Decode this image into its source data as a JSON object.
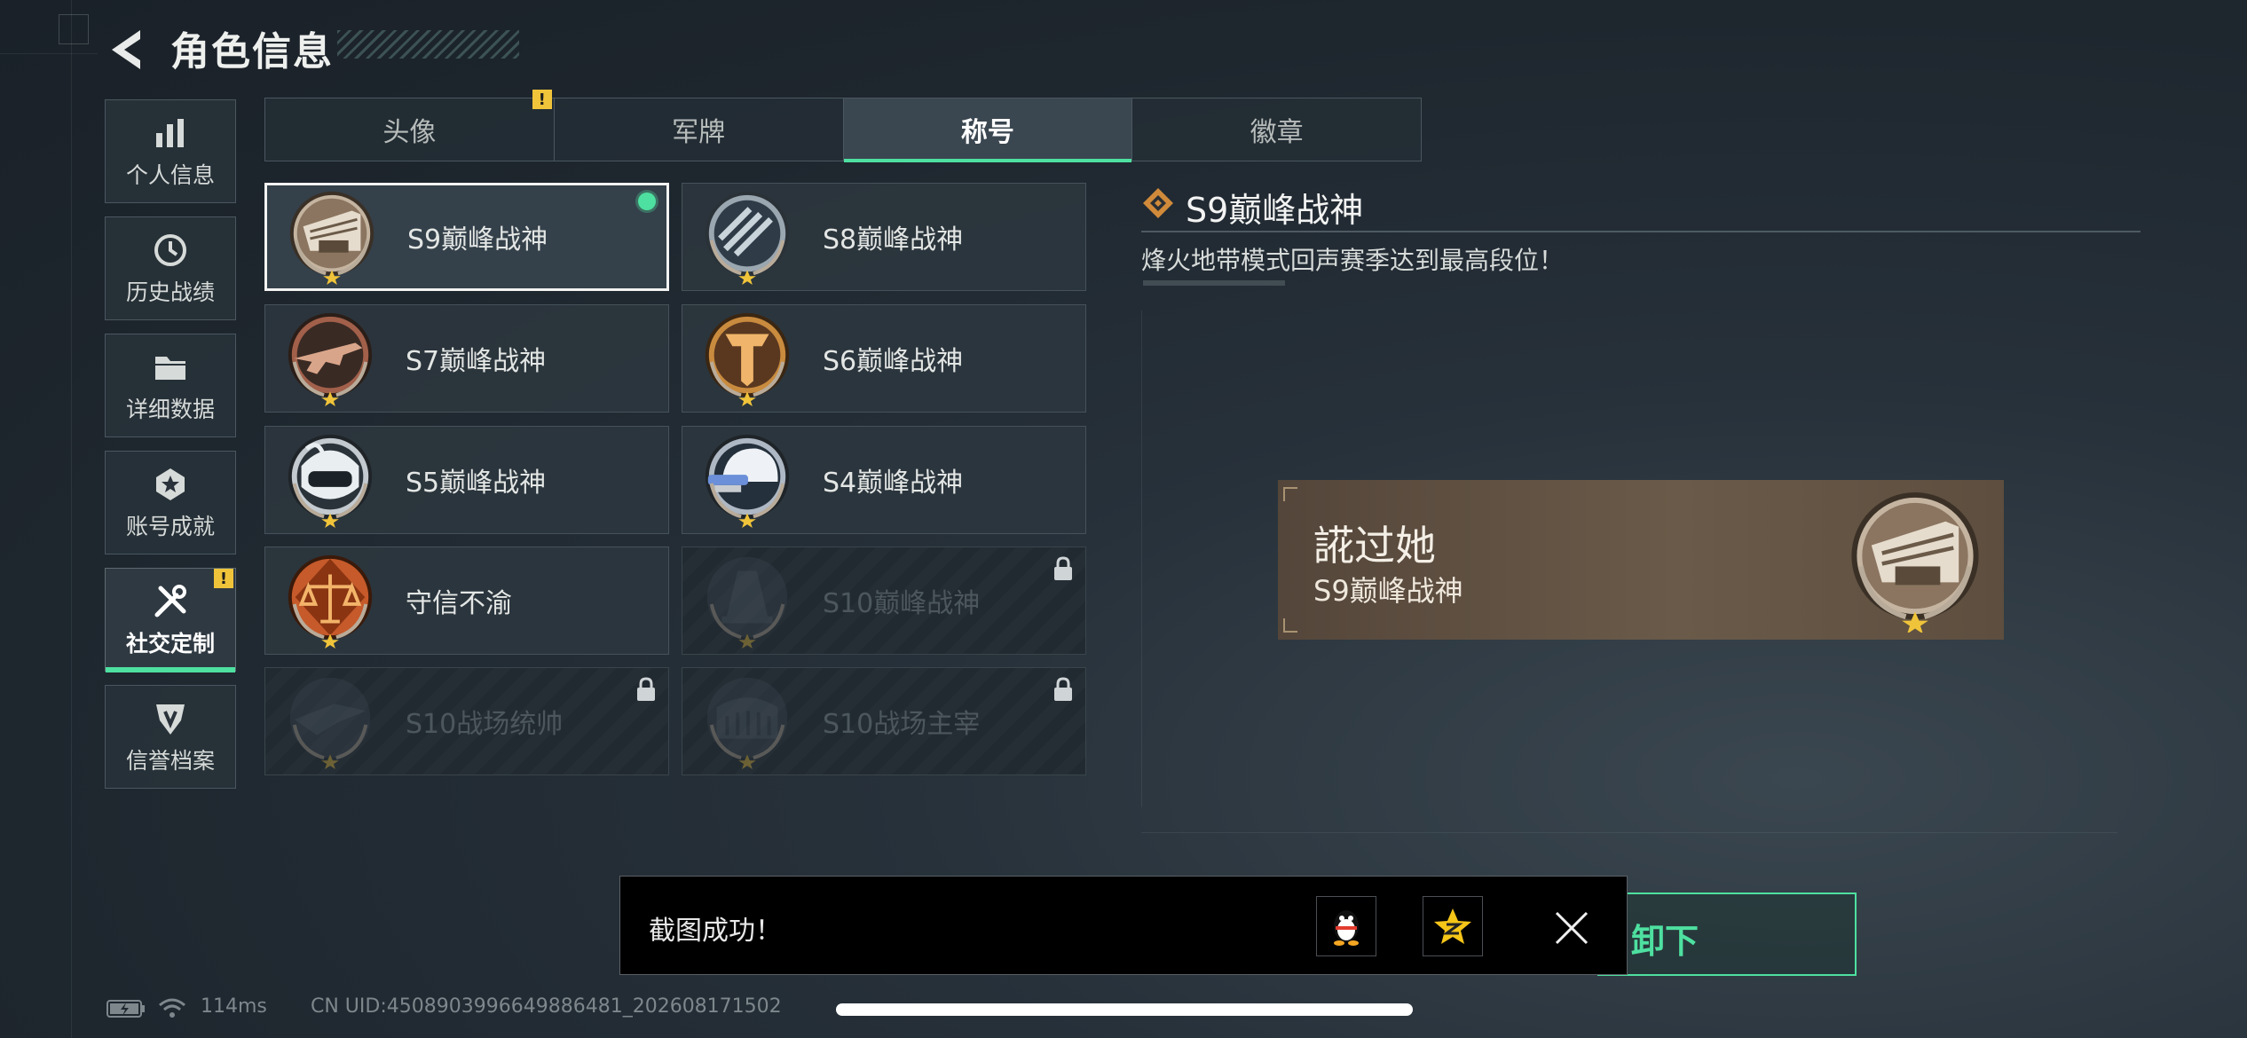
{
  "header": {
    "title": "角色信息"
  },
  "sidebar": {
    "items": [
      {
        "label": "个人信息",
        "icon": "bar-chart-icon"
      },
      {
        "label": "历史战绩",
        "icon": "clock-icon"
      },
      {
        "label": "详细数据",
        "icon": "folder-icon"
      },
      {
        "label": "账号成就",
        "icon": "medal-icon"
      },
      {
        "label": "社交定制",
        "icon": "tools-icon",
        "active": true,
        "alert": "!"
      },
      {
        "label": "信誉档案",
        "icon": "shield-icon"
      }
    ]
  },
  "tabs": [
    {
      "label": "头像",
      "alert": "!"
    },
    {
      "label": "军牌"
    },
    {
      "label": "称号",
      "active": true
    },
    {
      "label": "徽章"
    }
  ],
  "titles": [
    {
      "name": "S9巅峰战神",
      "selected": true,
      "equipped": true,
      "locked": false
    },
    {
      "name": "S8巅峰战神",
      "locked": false
    },
    {
      "name": "S7巅峰战神",
      "locked": false
    },
    {
      "name": "S6巅峰战神",
      "locked": false
    },
    {
      "name": "S5巅峰战神",
      "locked": false
    },
    {
      "name": "S4巅峰战神",
      "locked": false
    },
    {
      "name": "守信不渝",
      "locked": false
    },
    {
      "name": "S10巅峰战神",
      "locked": true
    },
    {
      "name": "S10战场统帅",
      "locked": true
    },
    {
      "name": "S10战场主宰",
      "locked": true
    }
  ],
  "detail": {
    "title": "S9巅峰战神",
    "description": "烽火地带模式回声赛季达到最高段位！",
    "preview_player_name": "誮过她",
    "preview_title": "S9巅峰战神"
  },
  "toast": {
    "message": "截图成功！",
    "share_qq_icon": "qq-penguin-icon",
    "share_qzone_icon": "qzone-star-icon",
    "close_icon": "close-icon"
  },
  "action_button": {
    "partial_label": "卸下"
  },
  "status_bar": {
    "ping": "114ms",
    "uid": "CN UID:4508903996649886481_202608171502"
  },
  "colors": {
    "accent": "#4ee0a0",
    "alert": "#f0c43a",
    "banner": "#6a5a49"
  }
}
